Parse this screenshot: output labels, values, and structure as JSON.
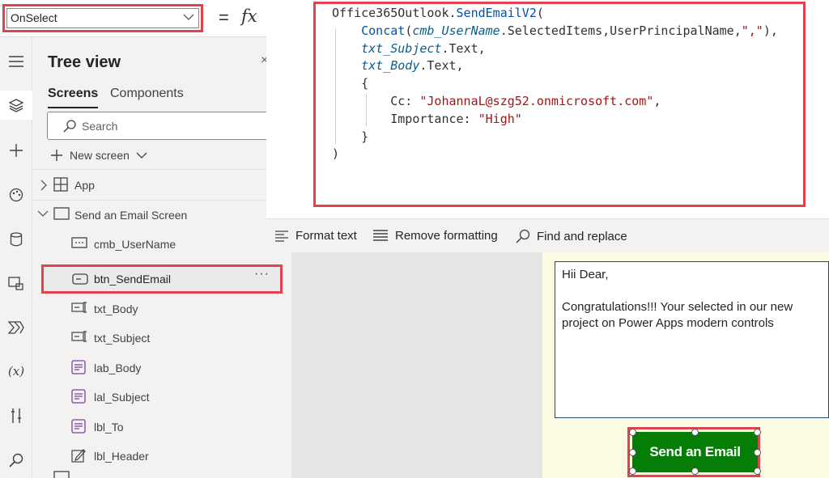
{
  "formula_bar": {
    "property": "OnSelect",
    "equals": "=",
    "fx": "fx"
  },
  "rail": {
    "icons": [
      "hamburger-icon",
      "layers-icon",
      "plus-icon",
      "palette-icon",
      "database-icon",
      "media-icon",
      "power-automate-icon",
      "variables-icon",
      "tools-icon",
      "search-icon"
    ],
    "variables_label": "(x)"
  },
  "tree_view": {
    "title": "Tree view",
    "close": "×",
    "tabs": [
      "Screens",
      "Components"
    ],
    "search_placeholder": "Search",
    "new_screen": "New screen",
    "nodes": [
      {
        "label": "App"
      },
      {
        "label": "Send an Email Screen"
      },
      {
        "label": "cmb_UserName"
      },
      {
        "label": "btn_SendEmail"
      },
      {
        "label": "txt_Body"
      },
      {
        "label": "txt_Subject"
      },
      {
        "label": "lab_Body"
      },
      {
        "label": "lal_Subject"
      },
      {
        "label": "lbl_To"
      },
      {
        "label": "lbl_Header"
      }
    ],
    "more": "···"
  },
  "code": {
    "l1_obj": "Office365Outlook.",
    "l1_fn": "SendEmailV2",
    "l1_paren": "(",
    "l2_fn": "Concat",
    "l2_a": "(",
    "l2_var": "cmb_UserName",
    "l2_b": ".SelectedItems,UserPrincipalName,",
    "l2_str": "\",\"",
    "l2_c": "),",
    "l3_var": "txt_Subject",
    "l3_b": ".Text,",
    "l4_var": "txt_Body",
    "l4_b": ".Text,",
    "l5": "{",
    "l6_key": "Cc: ",
    "l6_str": "\"JohannaL@szg52.onmicrosoft.com\"",
    "l6_c": ",",
    "l7_key": "Importance: ",
    "l7_str": "\"High\"",
    "l8": "}",
    "l9": ")"
  },
  "format_bar": {
    "format_text": "Format text",
    "remove_formatting": "Remove formatting",
    "find_replace": "Find and replace"
  },
  "canvas": {
    "body_text": "Hii Dear,\n\nCongratulations!!! Your selected in our new project on Power Apps modern controls",
    "send_button": "Send an Email",
    "button_color": "#067d06"
  },
  "colors": {
    "highlight": "#e0434d"
  }
}
